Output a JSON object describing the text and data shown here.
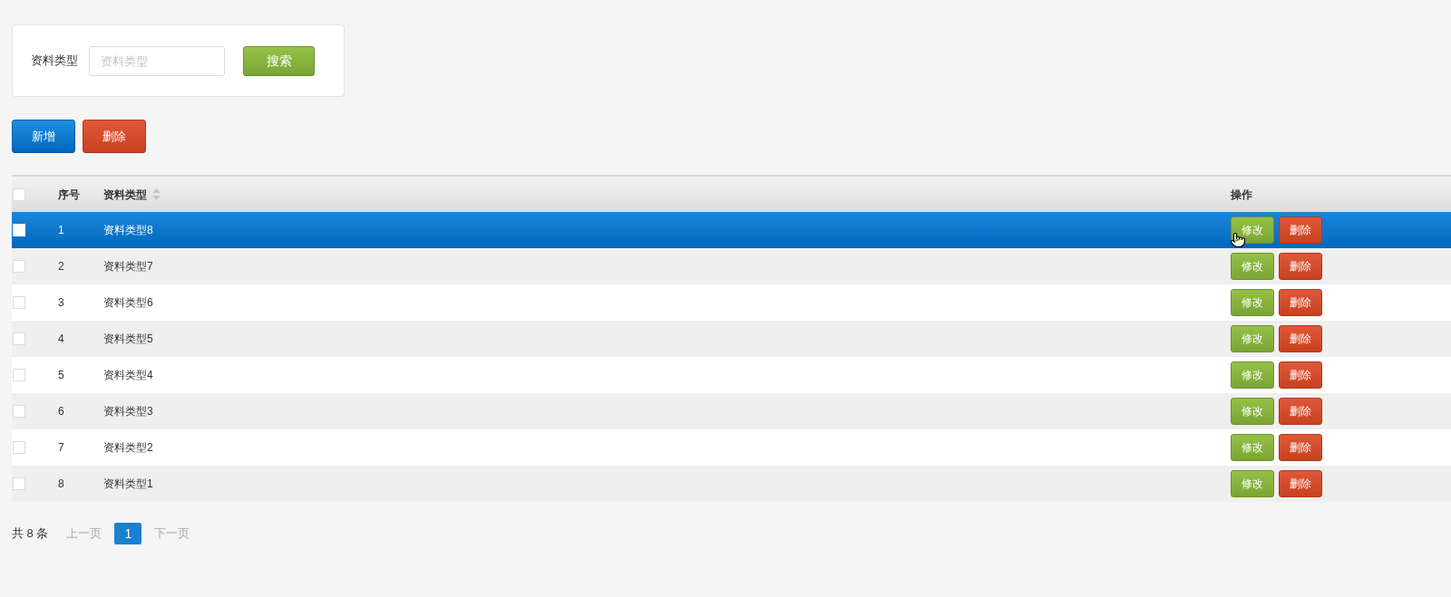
{
  "search": {
    "label": "资料类型",
    "placeholder": "资料类型",
    "button": "搜索"
  },
  "toolbar": [
    {
      "label": "新增",
      "kind": "primary"
    },
    {
      "label": "删除",
      "kind": "danger"
    }
  ],
  "table": {
    "select_all": {
      "checked": false
    },
    "columns": [
      {
        "label": "序号",
        "sortable": false
      },
      {
        "label": "资料类型",
        "sortable": true
      },
      {
        "label": "操作",
        "sortable": false
      }
    ],
    "rows": [
      {
        "index": "1",
        "name": "资料类型8",
        "selected": true,
        "checked": false,
        "actions": [
          {
            "label": "修改",
            "kind": "edit"
          },
          {
            "label": "删除",
            "kind": "delete"
          }
        ]
      },
      {
        "index": "2",
        "name": "资料类型7",
        "selected": false,
        "checked": false,
        "actions": [
          {
            "label": "修改",
            "kind": "edit"
          },
          {
            "label": "删除",
            "kind": "delete"
          }
        ]
      },
      {
        "index": "3",
        "name": "资料类型6",
        "selected": false,
        "checked": false,
        "actions": [
          {
            "label": "修改",
            "kind": "edit"
          },
          {
            "label": "删除",
            "kind": "delete"
          }
        ]
      },
      {
        "index": "4",
        "name": "资料类型5",
        "selected": false,
        "checked": false,
        "actions": [
          {
            "label": "修改",
            "kind": "edit"
          },
          {
            "label": "删除",
            "kind": "delete"
          }
        ]
      },
      {
        "index": "5",
        "name": "资料类型4",
        "selected": false,
        "checked": false,
        "actions": [
          {
            "label": "修改",
            "kind": "edit"
          },
          {
            "label": "删除",
            "kind": "delete"
          }
        ]
      },
      {
        "index": "6",
        "name": "资料类型3",
        "selected": false,
        "checked": false,
        "actions": [
          {
            "label": "修改",
            "kind": "edit"
          },
          {
            "label": "删除",
            "kind": "delete"
          }
        ]
      },
      {
        "index": "7",
        "name": "资料类型2",
        "selected": false,
        "checked": false,
        "actions": [
          {
            "label": "修改",
            "kind": "edit"
          },
          {
            "label": "删除",
            "kind": "delete"
          }
        ]
      },
      {
        "index": "8",
        "name": "资料类型1",
        "selected": false,
        "checked": false,
        "actions": [
          {
            "label": "修改",
            "kind": "edit"
          },
          {
            "label": "删除",
            "kind": "delete"
          }
        ]
      }
    ]
  },
  "pagination": {
    "total": "共 8 条",
    "prev": {
      "label": "上一页",
      "disabled": true
    },
    "pages": [
      {
        "label": "1",
        "selected": true
      }
    ],
    "next": {
      "label": "下一页",
      "disabled": true
    }
  }
}
